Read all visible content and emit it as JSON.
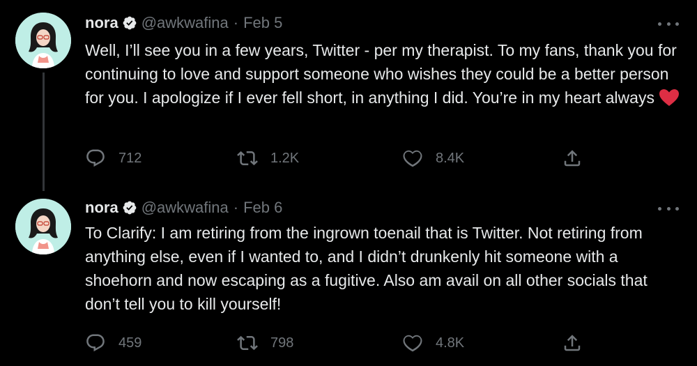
{
  "tweets": [
    {
      "author": {
        "name": "nora",
        "handle": "@awkwafina",
        "verified": true
      },
      "date": "Feb 5",
      "separator": "·",
      "text": "Well, I’ll see you in a few years, Twitter - per my therapist. To my fans, thank you for continuing to love and support someone who wishes they could be a better person for you. I apologize if I ever fell short, in anything I did. You’re in my heart always",
      "emoji": "red-heart",
      "stats": {
        "replies": "712",
        "retweets": "1.2K",
        "likes": "8.4K"
      }
    },
    {
      "author": {
        "name": "nora",
        "handle": "@awkwafina",
        "verified": true
      },
      "date": "Feb 6",
      "separator": "·",
      "text": "To Clarify: I am retiring from the ingrown toenail that is Twitter. Not retiring from anything else, even if I wanted to, and I didn’t drunkenly hit someone with a shoehorn and now escaping as a fugitive. Also am avail on all other socials that don’t tell you to kill yourself!",
      "stats": {
        "replies": "459",
        "retweets": "798",
        "likes": "4.8K"
      }
    }
  ],
  "colors": {
    "background": "#000000",
    "text_primary": "#e7e9ea",
    "text_secondary": "#71767b",
    "thread_line": "#333639",
    "avatar_bg": "#bfeee6",
    "heart": "#e0245e"
  },
  "icons": [
    "avatar",
    "verified-badge-icon",
    "more-icon",
    "reply-icon",
    "retweet-icon",
    "like-icon",
    "share-icon",
    "red-heart-emoji"
  ]
}
